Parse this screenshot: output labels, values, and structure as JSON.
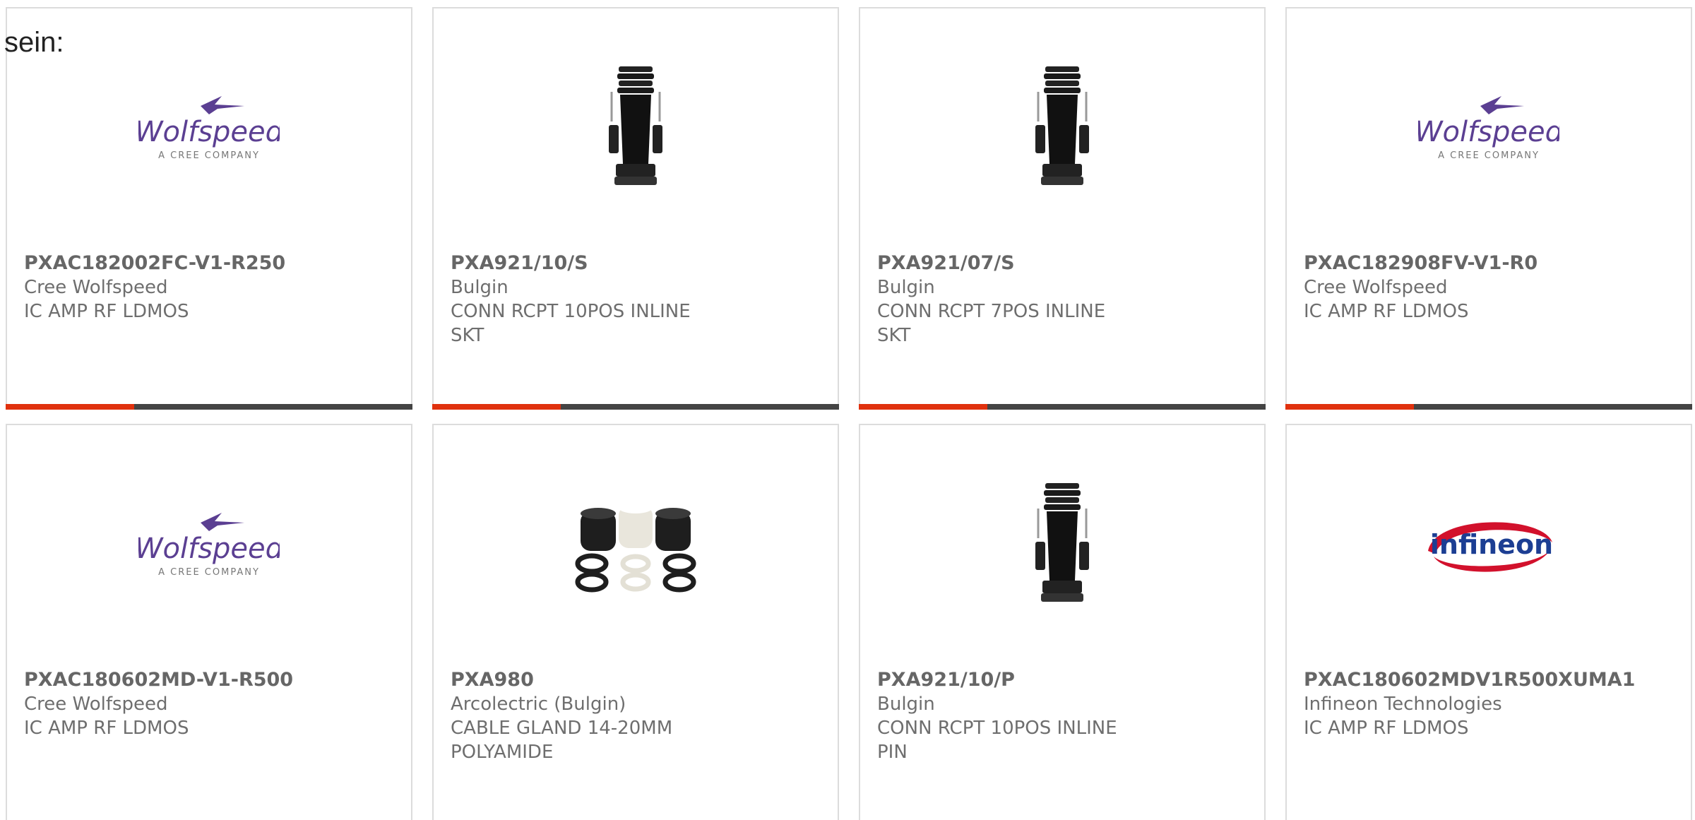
{
  "lead_text": "sein:",
  "colors": {
    "accent": "#e0310e",
    "bar_dark": "#444444",
    "border": "#dcdcdc",
    "text": "#6e6e6e",
    "wolfspeed_purple": "#5b3f92",
    "infineon_blue": "#1c3e93",
    "infineon_red": "#d2112c"
  },
  "products": [
    {
      "part_number": "PXAC182002FC-V1-R250",
      "manufacturer": "Cree Wolfspeed",
      "description": "IC AMP RF LDMOS",
      "image": "wolfspeed-logo",
      "logo_name": "Wolfspeed",
      "logo_tagline": "A CREE COMPANY"
    },
    {
      "part_number": "PXA921/10/S",
      "manufacturer": "Bulgin",
      "description": "CONN RCPT 10POS INLINE SKT",
      "image": "connector-image"
    },
    {
      "part_number": "PXA921/07/S",
      "manufacturer": "Bulgin",
      "description": "CONN RCPT 7POS INLINE SKT",
      "image": "connector-image"
    },
    {
      "part_number": "PXAC182908FV-V1-R0",
      "manufacturer": "Cree Wolfspeed",
      "description": "IC AMP RF LDMOS",
      "image": "wolfspeed-logo",
      "logo_name": "Wolfspeed",
      "logo_tagline": "A CREE COMPANY"
    },
    {
      "part_number": "PXAC180602MD-V1-R500",
      "manufacturer": "Cree Wolfspeed",
      "description": "IC AMP RF LDMOS",
      "image": "wolfspeed-logo",
      "logo_name": "Wolfspeed",
      "logo_tagline": "A CREE COMPANY"
    },
    {
      "part_number": "PXA980",
      "manufacturer": "Arcolectric (Bulgin)",
      "description": "CABLE GLAND 14-20MM POLYAMIDE",
      "image": "cable-gland-image"
    },
    {
      "part_number": "PXA921/10/P",
      "manufacturer": "Bulgin",
      "description": "CONN RCPT 10POS INLINE PIN",
      "image": "connector-image"
    },
    {
      "part_number": "PXAC180602MDV1R500XUMA1",
      "manufacturer": "Infineon Technologies",
      "description": "IC AMP RF LDMOS",
      "image": "infineon-logo",
      "logo_name": "infineon"
    }
  ]
}
